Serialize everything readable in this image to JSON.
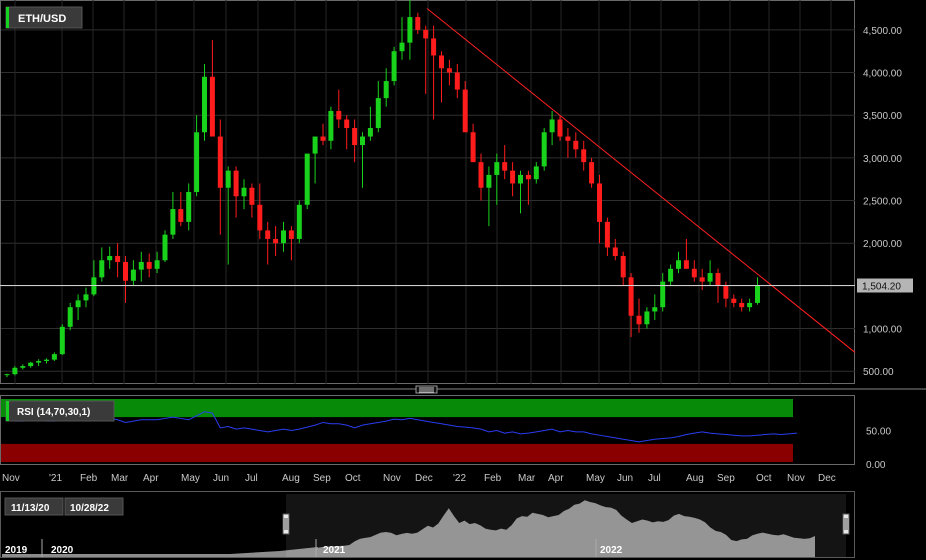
{
  "chart_data": {
    "type": "candlestick",
    "symbol": "ETH/USD",
    "current_price": "1,504.20",
    "y_ticks": [
      "500.00",
      "1,000.00",
      "1,500.00",
      "2,000.00",
      "2,500.00",
      "3,000.00",
      "3,500.00",
      "4,000.00",
      "4,500.00"
    ],
    "y_tick_values": [
      500,
      1000,
      1500,
      2000,
      2500,
      3000,
      3500,
      4000,
      4500
    ],
    "ylim": [
      350,
      4850
    ],
    "month_labels": [
      "Nov",
      "'21",
      "Feb",
      "Mar",
      "Apr",
      "May",
      "Jun",
      "Jul",
      "Aug",
      "Sep",
      "Oct",
      "Nov",
      "Dec",
      "'22",
      "Feb",
      "Mar",
      "Apr",
      "May",
      "Jun",
      "Jul",
      "Aug",
      "Sep",
      "Oct",
      "Nov",
      "Dec"
    ],
    "candles": [
      [
        460,
        470,
        430,
        465
      ],
      [
        465,
        560,
        450,
        540
      ],
      [
        540,
        580,
        520,
        560
      ],
      [
        560,
        610,
        540,
        600
      ],
      [
        600,
        640,
        560,
        620
      ],
      [
        620,
        650,
        590,
        635
      ],
      [
        635,
        720,
        620,
        700
      ],
      [
        700,
        1050,
        690,
        1020
      ],
      [
        1020,
        1300,
        980,
        1250
      ],
      [
        1250,
        1400,
        1100,
        1330
      ],
      [
        1330,
        1480,
        1250,
        1400
      ],
      [
        1400,
        1800,
        1380,
        1600
      ],
      [
        1600,
        1950,
        1550,
        1800
      ],
      [
        1800,
        1960,
        1700,
        1850
      ],
      [
        1850,
        2000,
        1600,
        1780
      ],
      [
        1780,
        1850,
        1300,
        1560
      ],
      [
        1560,
        1800,
        1500,
        1690
      ],
      [
        1690,
        1900,
        1550,
        1780
      ],
      [
        1780,
        1880,
        1600,
        1700
      ],
      [
        1700,
        1900,
        1650,
        1800
      ],
      [
        1800,
        2150,
        1780,
        2100
      ],
      [
        2100,
        2600,
        2050,
        2400
      ],
      [
        2400,
        2600,
        2200,
        2250
      ],
      [
        2250,
        2700,
        2150,
        2600
      ],
      [
        2600,
        3500,
        2550,
        3300
      ],
      [
        3300,
        4100,
        3200,
        3950
      ],
      [
        3950,
        4380,
        3650,
        3250
      ],
      [
        3250,
        3450,
        2100,
        2650
      ],
      [
        2650,
        2900,
        1750,
        2850
      ],
      [
        2850,
        2900,
        2300,
        2550
      ],
      [
        2550,
        2750,
        2400,
        2650
      ],
      [
        2650,
        2700,
        2300,
        2450
      ],
      [
        2450,
        2700,
        2050,
        2150
      ],
      [
        2150,
        2250,
        1750,
        2050
      ],
      [
        2050,
        2200,
        1850,
        2000
      ],
      [
        2000,
        2250,
        1900,
        2150
      ],
      [
        2150,
        2200,
        1800,
        2050
      ],
      [
        2050,
        2500,
        2000,
        2450
      ],
      [
        2450,
        2900,
        2400,
        3050
      ],
      [
        3050,
        3200,
        2700,
        3250
      ],
      [
        3250,
        3400,
        3150,
        3200
      ],
      [
        3200,
        3600,
        3100,
        3550
      ],
      [
        3550,
        3800,
        3350,
        3450
      ],
      [
        3450,
        3500,
        3100,
        3350
      ],
      [
        3350,
        3450,
        2950,
        3150
      ],
      [
        3150,
        3300,
        2650,
        3250
      ],
      [
        3250,
        3600,
        3200,
        3350
      ],
      [
        3350,
        3900,
        3300,
        3700
      ],
      [
        3700,
        4050,
        3600,
        3900
      ],
      [
        3900,
        4300,
        3850,
        4250
      ],
      [
        4250,
        4650,
        4150,
        4350
      ],
      [
        4350,
        4850,
        4150,
        4650
      ],
      [
        4650,
        4700,
        4450,
        4500
      ],
      [
        4500,
        4550,
        3750,
        4400
      ],
      [
        4400,
        4550,
        3450,
        4200
      ],
      [
        4200,
        4250,
        3650,
        4050
      ],
      [
        4050,
        4150,
        3850,
        4000
      ],
      [
        4000,
        4100,
        3700,
        3800
      ],
      [
        3800,
        3900,
        3350,
        3300
      ],
      [
        3300,
        3400,
        2950,
        2950
      ],
      [
        2950,
        3050,
        2500,
        2650
      ],
      [
        2650,
        2900,
        2200,
        2800
      ],
      [
        2800,
        3050,
        2450,
        2950
      ],
      [
        2950,
        3150,
        2750,
        2850
      ],
      [
        2850,
        2950,
        2550,
        2700
      ],
      [
        2700,
        2850,
        2350,
        2800
      ],
      [
        2800,
        2850,
        2450,
        2750
      ],
      [
        2750,
        2950,
        2700,
        2900
      ],
      [
        2900,
        3350,
        2850,
        3300
      ],
      [
        3300,
        3550,
        3150,
        3450
      ],
      [
        3450,
        3500,
        3200,
        3250
      ],
      [
        3250,
        3350,
        3000,
        3200
      ],
      [
        3200,
        3300,
        3000,
        3100
      ],
      [
        3100,
        3200,
        2850,
        2950
      ],
      [
        2950,
        3000,
        2650,
        2700
      ],
      [
        2700,
        2800,
        2000,
        2250
      ],
      [
        2250,
        2300,
        1850,
        1950
      ],
      [
        1950,
        2050,
        1800,
        1850
      ],
      [
        1850,
        1900,
        1500,
        1600
      ],
      [
        1600,
        1650,
        900,
        1150
      ],
      [
        1150,
        1350,
        950,
        1050
      ],
      [
        1050,
        1250,
        1000,
        1200
      ],
      [
        1200,
        1400,
        1100,
        1250
      ],
      [
        1250,
        1650,
        1200,
        1550
      ],
      [
        1550,
        1750,
        1500,
        1700
      ],
      [
        1700,
        1900,
        1650,
        1800
      ],
      [
        1800,
        2050,
        1700,
        1700
      ],
      [
        1700,
        1800,
        1550,
        1600
      ],
      [
        1600,
        1700,
        1450,
        1550
      ],
      [
        1550,
        1800,
        1500,
        1650
      ],
      [
        1650,
        1700,
        1300,
        1500
      ],
      [
        1500,
        1550,
        1250,
        1350
      ],
      [
        1350,
        1400,
        1250,
        1300
      ],
      [
        1300,
        1350,
        1200,
        1250
      ],
      [
        1250,
        1350,
        1200,
        1300
      ],
      [
        1300,
        1600,
        1280,
        1504
      ]
    ],
    "trendline": {
      "start_price": 4750,
      "end_price": 720
    },
    "rsi": {
      "label": "RSI (14,70,30,1)",
      "overbought": 70,
      "oversold": 30,
      "y_ticks": [
        "50.00",
        "0.00"
      ],
      "values": [
        66,
        64,
        64,
        66,
        66,
        64,
        64,
        66,
        68,
        66,
        64,
        66,
        66,
        68,
        66,
        62,
        64,
        66,
        66,
        66,
        68,
        70,
        68,
        66,
        72,
        78,
        76,
        54,
        56,
        52,
        54,
        52,
        50,
        48,
        50,
        52,
        50,
        52,
        55,
        58,
        62,
        60,
        60,
        58,
        54,
        58,
        60,
        62,
        64,
        67,
        66,
        68,
        66,
        64,
        62,
        60,
        58,
        56,
        55,
        54,
        52,
        48,
        50,
        46,
        48,
        45,
        46,
        48,
        50,
        52,
        48,
        50,
        48,
        48,
        45,
        43,
        41,
        39,
        37,
        35,
        33,
        35,
        37,
        38,
        39,
        41,
        44,
        46,
        48,
        46,
        45,
        44,
        43,
        42,
        42,
        43,
        44,
        45,
        44,
        45,
        46
      ]
    },
    "navigator": {
      "start_date": "11/13/20",
      "end_date": "10/28/22",
      "year_labels": [
        "2019",
        "2020",
        "2021",
        "2022"
      ]
    }
  }
}
